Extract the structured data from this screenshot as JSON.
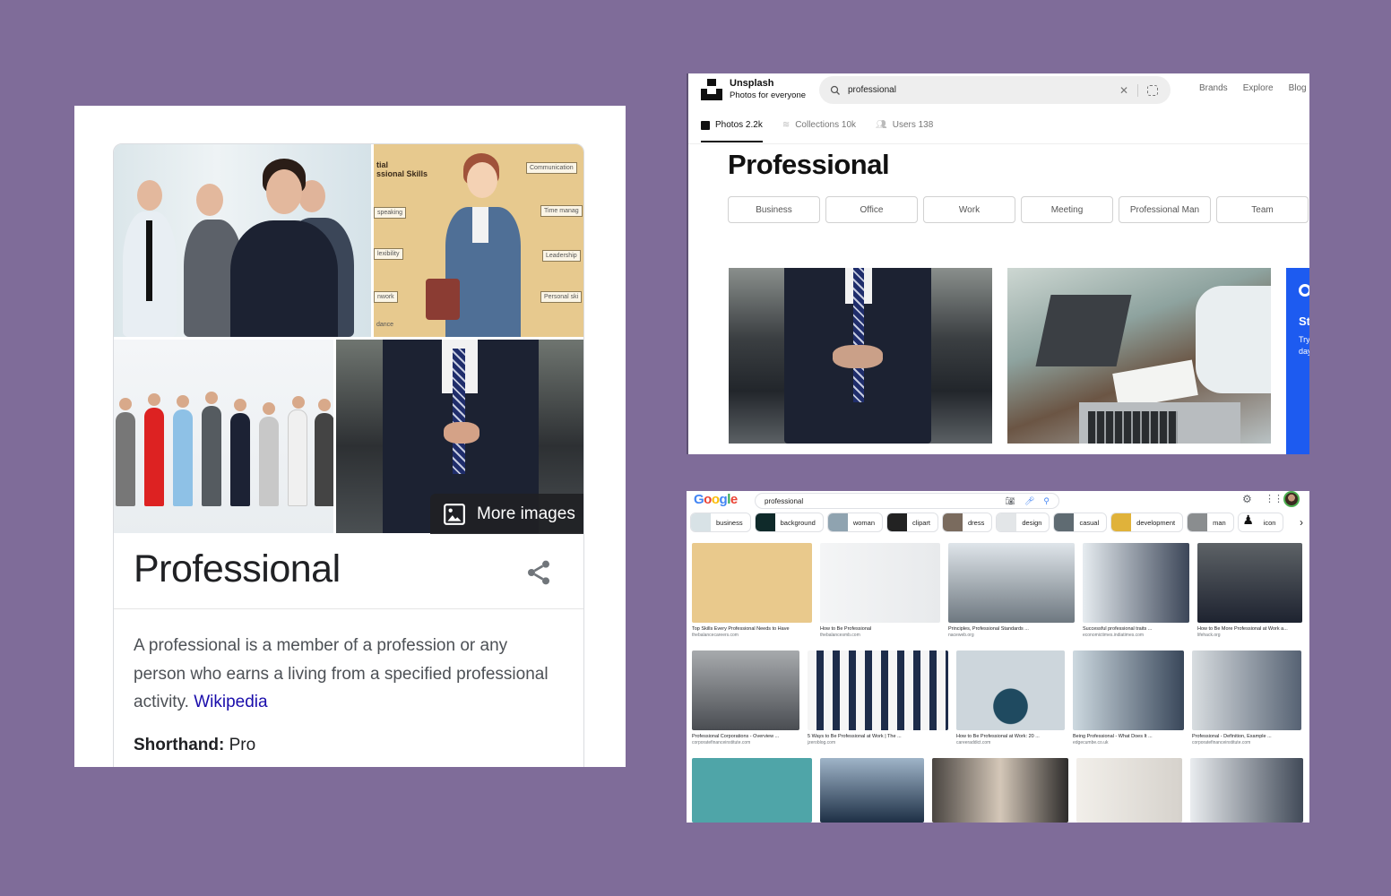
{
  "knowledge_panel": {
    "more_images_label": "More images",
    "title": "Professional",
    "description": "A professional is a member of a profession or any person who earns a living from a specified professional activity.",
    "source_link": "Wikipedia",
    "shorthand_label": "Shorthand:",
    "shorthand_value": "Pro",
    "images": [
      {
        "alt": "Business team group photo"
      },
      {
        "alt": "Essential Professional Skills illustration"
      },
      {
        "alt": "Workers of different professions"
      },
      {
        "alt": "Man in suit buttoning jacket on stairs"
      }
    ],
    "illustration_labels": [
      "tial",
      "ssional Skills",
      "Communication",
      "speaking",
      "Time manag",
      "lexibility",
      "Leadership",
      "nwork",
      "Personal ski",
      "dance"
    ]
  },
  "unsplash": {
    "brand_name": "Unsplash",
    "brand_tagline": "Photos for everyone",
    "search_value": "professional",
    "nav": [
      "Brands",
      "Explore",
      "Blog"
    ],
    "tabs": [
      {
        "label": "Photos 2.2k",
        "active": true
      },
      {
        "label": "Collections 10k",
        "active": false
      },
      {
        "label": "Users 138",
        "active": false
      }
    ],
    "page_title": "Professional",
    "related_chips": [
      "Business",
      "Office",
      "Work",
      "Meeting",
      "Professional Man",
      "Team"
    ],
    "photos": [
      {
        "alt": "Man in suit on stairs"
      },
      {
        "alt": "Hands writing beside laptops"
      }
    ],
    "ad": {
      "heading": "St",
      "text_line1": "Try",
      "text_line2": "day",
      "color": "#1d5bf0"
    }
  },
  "google_images": {
    "logo": "Google",
    "search_value": "professional",
    "chips": [
      "business",
      "background",
      "woman",
      "clipart",
      "dress",
      "design",
      "casual",
      "development",
      "man",
      "icon"
    ],
    "rows": [
      [
        {
          "caption": "Top Skills Every Professional Needs to Have",
          "source": "thebalancecareers.com"
        },
        {
          "caption": "How to Be Professional",
          "source": "thebalancesmb.com"
        },
        {
          "caption": "Principles, Professional Standards ...",
          "source": "naceweb.org"
        },
        {
          "caption": "Successful professional traits ...",
          "source": "economictimes.indiatimes.com"
        },
        {
          "caption": "How to Be More Professional at Work a...",
          "source": "lifehack.org"
        }
      ],
      [
        {
          "caption": "Professional Corporations - Overview ...",
          "source": "corporatefinanceinstitute.com"
        },
        {
          "caption": "5 Ways to Be Professional at Work | The ...",
          "source": "jzeroblog.com"
        },
        {
          "caption": "How to Be Professional at Work: 20 ...",
          "source": "careeraddict.com"
        },
        {
          "caption": "Being Professional - What Does It ...",
          "source": "edgecumbe.co.uk"
        },
        {
          "caption": "Professional - Definition, Example ...",
          "source": "corporatefinanceinstitute.com"
        }
      ],
      [
        {
          "caption": "",
          "source": ""
        },
        {
          "caption": "",
          "source": ""
        },
        {
          "caption": "",
          "source": ""
        },
        {
          "caption": "",
          "source": ""
        },
        {
          "caption": "",
          "source": ""
        }
      ]
    ]
  },
  "colors": {
    "background": "#7f6c99",
    "link": "#1a0dab",
    "google_blue": "#4285f4",
    "google_red": "#ea4335",
    "google_yellow": "#fbbc05",
    "google_green": "#34a853"
  }
}
